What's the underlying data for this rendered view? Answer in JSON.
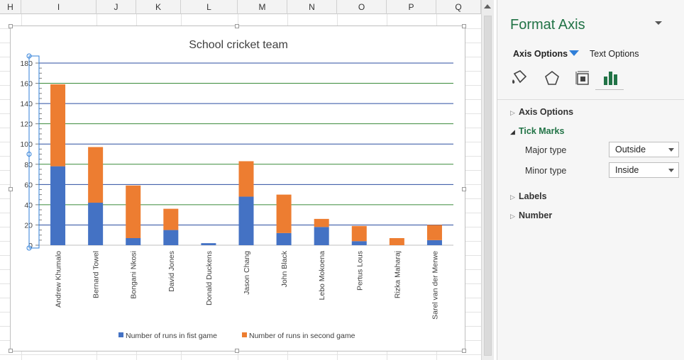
{
  "columns": [
    "H",
    "I",
    "J",
    "K",
    "L",
    "M",
    "N",
    "O",
    "P",
    "Q"
  ],
  "chart": {
    "title": "School cricket team",
    "colors": {
      "series1": "#4472c4",
      "series2": "#ed7d31",
      "gridline": "#2b4ea0",
      "gridline_alt": "#3a8a3a"
    }
  },
  "chart_data": {
    "type": "bar",
    "stacked": true,
    "title": "School cricket team",
    "categories": [
      "Andrew Khumalo",
      "Bernard Towel",
      "Bongani Nkosi",
      "David Jones",
      "Donald Duckens",
      "Jason Chang",
      "John Black",
      "Lebo Mokoena",
      "Pertus Lous",
      "Rizka Maharaj",
      "Sarel van der Merwe"
    ],
    "series": [
      {
        "name": "Number of runs in fist game",
        "values": [
          78,
          42,
          7,
          15,
          2,
          48,
          12,
          18,
          4,
          0,
          5
        ],
        "color": "#4472c4"
      },
      {
        "name": "Number of runs in second game",
        "values": [
          81,
          55,
          52,
          21,
          0,
          35,
          38,
          8,
          15,
          7,
          15
        ],
        "color": "#ed7d31"
      }
    ],
    "yticks": [
      0,
      20,
      40,
      60,
      80,
      100,
      120,
      140,
      160,
      180
    ],
    "ylim": [
      0,
      180
    ],
    "grid": true,
    "legend": "bottom"
  },
  "pane": {
    "title": "Format Axis",
    "tabs": {
      "axis_options": "Axis Options",
      "text_options": "Text Options"
    },
    "icons": [
      "fill-line-icon",
      "effects-icon",
      "size-properties-icon",
      "axis-options-icon"
    ],
    "sections": {
      "axis_options": "Axis Options",
      "tick_marks": "Tick Marks",
      "labels": "Labels",
      "number": "Number"
    },
    "tick_marks": {
      "major_label": "Major type",
      "major_value": "Outside",
      "minor_label": "Minor type",
      "minor_value": "Inside"
    },
    "accent_color": "#217346"
  }
}
